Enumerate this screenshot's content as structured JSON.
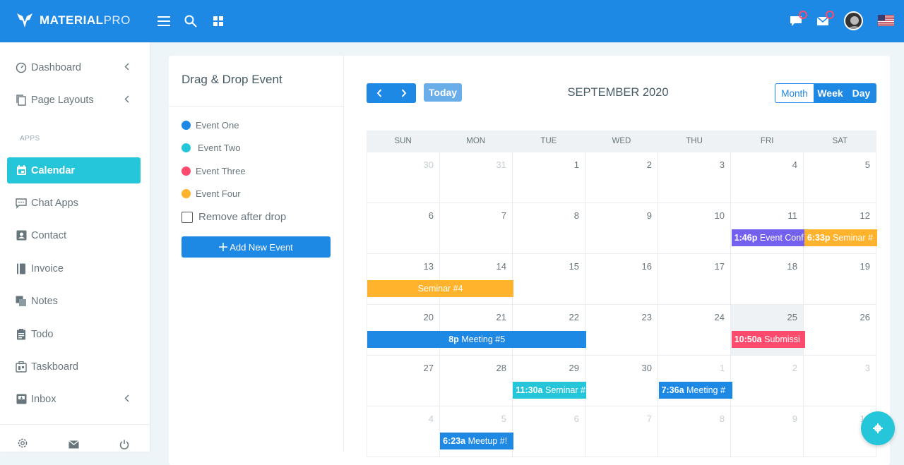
{
  "brand": {
    "name_bold": "MATERIAL",
    "name_light": "PRO"
  },
  "topbar": {
    "icons": [
      "menu-icon",
      "search-icon",
      "grid-icon",
      "message-icon",
      "mail-icon"
    ],
    "accent": "#1e88e5"
  },
  "sidebar": {
    "items": [
      {
        "label": "Dashboard",
        "icon": "dashboard-icon",
        "chevron": true
      },
      {
        "label": "Page Layouts",
        "icon": "layouts-icon",
        "chevron": true
      },
      {
        "label": "Calendar",
        "icon": "calendar-icon",
        "active": true
      },
      {
        "label": "Chat Apps",
        "icon": "chat-icon"
      },
      {
        "label": "Contact",
        "icon": "contact-icon"
      },
      {
        "label": "Invoice",
        "icon": "invoice-icon"
      },
      {
        "label": "Notes",
        "icon": "notes-icon"
      },
      {
        "label": "Todo",
        "icon": "todo-icon"
      },
      {
        "label": "Taskboard",
        "icon": "taskboard-icon"
      },
      {
        "label": "Inbox",
        "icon": "inbox-icon",
        "chevron": true
      }
    ],
    "caption": "APPS",
    "active_color": "#26c6da"
  },
  "drag_panel": {
    "title": "Drag & Drop Event",
    "events": [
      {
        "label": "Event One",
        "color": "#1e88e5"
      },
      {
        "label": "Event Two",
        "color": "#26c6da"
      },
      {
        "label": "Event Three",
        "color": "#fc4b6c"
      },
      {
        "label": "Event Four",
        "color": "#ffb22b"
      }
    ],
    "remove_label": "Remove after drop",
    "add_label": "Add New Event"
  },
  "calendar": {
    "today_label": "Today",
    "title": "SEPTEMBER 2020",
    "views": {
      "month": "Month",
      "week": "Week",
      "day": "Day"
    },
    "dow": [
      "SUN",
      "MON",
      "TUE",
      "WED",
      "THU",
      "FRI",
      "SAT"
    ],
    "weeks": [
      [
        {
          "n": "30",
          "o": true
        },
        {
          "n": "31",
          "o": true
        },
        {
          "n": "1"
        },
        {
          "n": "2"
        },
        {
          "n": "3"
        },
        {
          "n": "4"
        },
        {
          "n": "5"
        }
      ],
      [
        {
          "n": "6"
        },
        {
          "n": "7"
        },
        {
          "n": "8"
        },
        {
          "n": "9"
        },
        {
          "n": "10"
        },
        {
          "n": "11"
        },
        {
          "n": "12"
        }
      ],
      [
        {
          "n": "13"
        },
        {
          "n": "14"
        },
        {
          "n": "15"
        },
        {
          "n": "16"
        },
        {
          "n": "17"
        },
        {
          "n": "18"
        },
        {
          "n": "19"
        }
      ],
      [
        {
          "n": "20"
        },
        {
          "n": "21"
        },
        {
          "n": "22"
        },
        {
          "n": "23"
        },
        {
          "n": "24"
        },
        {
          "n": "25",
          "today": true
        },
        {
          "n": "26"
        }
      ],
      [
        {
          "n": "27"
        },
        {
          "n": "28"
        },
        {
          "n": "29"
        },
        {
          "n": "30"
        },
        {
          "n": "1",
          "o": true
        },
        {
          "n": "2",
          "o": true
        },
        {
          "n": "3",
          "o": true
        }
      ],
      [
        {
          "n": "4",
          "o": true
        },
        {
          "n": "5",
          "o": true
        },
        {
          "n": "6",
          "o": true
        },
        {
          "n": "7",
          "o": true
        },
        {
          "n": "8",
          "o": true
        },
        {
          "n": "9",
          "o": true
        },
        {
          "n": "10",
          "o": true
        }
      ]
    ],
    "events": [
      {
        "week": 1,
        "start": 5,
        "span": 1,
        "time": "1:46p",
        "title": "Event Conf",
        "color": "#7460ee"
      },
      {
        "week": 1,
        "start": 6,
        "span": 1,
        "time": "6:33p",
        "title": "Seminar #",
        "color": "#ffb22b"
      },
      {
        "week": 2,
        "start": 0,
        "span": 2,
        "time": "",
        "title": "Seminar #4",
        "color": "#ffb22b",
        "center": true
      },
      {
        "week": 3,
        "start": 0,
        "span": 3,
        "time": "8p",
        "title": "Meeting #5",
        "color": "#1e88e5",
        "center": true
      },
      {
        "week": 3,
        "start": 5,
        "span": 1,
        "time": "10:50a",
        "title": "Submissi",
        "color": "#fc4b6c"
      },
      {
        "week": 4,
        "start": 2,
        "span": 1,
        "time": "11:30a",
        "title": "Seminar #",
        "color": "#26c6da"
      },
      {
        "week": 4,
        "start": 4,
        "span": 1,
        "time": "7:36a",
        "title": "Meeting #",
        "color": "#1e88e5"
      },
      {
        "week": 5,
        "start": 1,
        "span": 1,
        "time": "6:23a",
        "title": "Meetup #!",
        "color": "#1e88e5"
      }
    ]
  }
}
